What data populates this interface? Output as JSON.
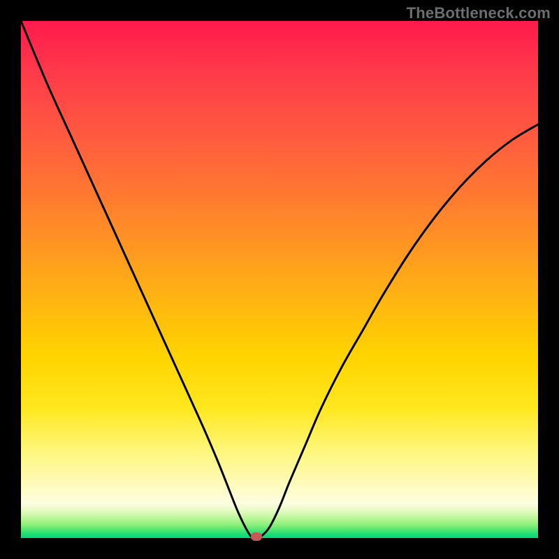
{
  "watermark": "TheBottleneck.com",
  "chart_data": {
    "type": "line",
    "title": "",
    "xlabel": "",
    "ylabel": "",
    "xlim": [
      0,
      100
    ],
    "ylim": [
      0,
      100
    ],
    "grid": false,
    "series": [
      {
        "name": "bottleneck-curve",
        "x": [
          0,
          5,
          10,
          15,
          20,
          25,
          30,
          35,
          38,
          40,
          42,
          44,
          45,
          46,
          48,
          50,
          52,
          55,
          58,
          62,
          66,
          70,
          75,
          80,
          85,
          90,
          95,
          100
        ],
        "values": [
          100,
          88,
          77,
          66,
          55,
          44,
          33,
          22,
          15,
          10,
          5,
          1,
          0,
          0,
          2,
          6,
          11,
          18,
          25,
          33,
          40,
          47,
          55,
          62,
          68,
          73,
          77,
          80
        ]
      }
    ],
    "annotations": [
      {
        "name": "min-marker",
        "x": 45.5,
        "y": 0,
        "color": "#c65858"
      }
    ],
    "background_gradient": {
      "top": "#ff1a4d",
      "mid": "#ffd400",
      "bottom": "#00d877"
    }
  }
}
